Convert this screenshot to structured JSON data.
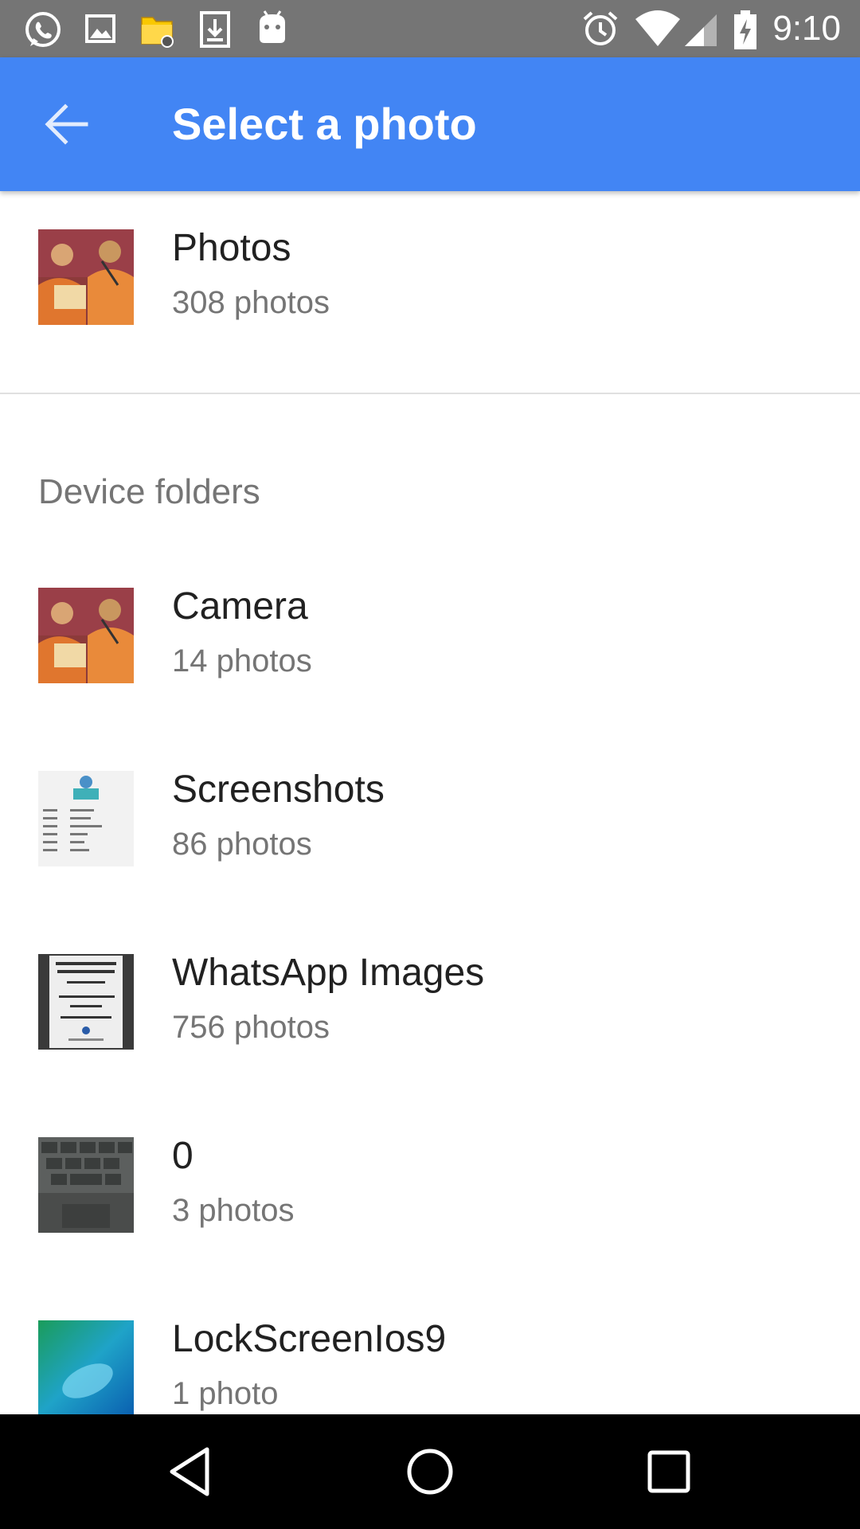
{
  "status_bar": {
    "time": "9:10",
    "left_icons": [
      "whatsapp-icon",
      "gallery-icon",
      "file-manager-icon",
      "download-icon",
      "android-icon"
    ],
    "right_icons": [
      "alarm-icon",
      "wifi-icon",
      "signal-icon",
      "battery-charging-icon"
    ]
  },
  "app_bar": {
    "title": "Select a photo",
    "back_icon": "arrow-back-icon",
    "color": "#4285f4"
  },
  "top_album": {
    "title": "Photos",
    "count": "308 photos"
  },
  "section": {
    "header": "Device folders"
  },
  "folders": [
    {
      "title": "Camera",
      "count": "14 photos"
    },
    {
      "title": "Screenshots",
      "count": "86 photos"
    },
    {
      "title": "WhatsApp Images",
      "count": "756 photos"
    },
    {
      "title": "0",
      "count": "3 photos"
    },
    {
      "title": "LockScreenIos9",
      "count": "1 photo"
    }
  ],
  "nav_bar": {
    "buttons": [
      "back-nav-icon",
      "home-nav-icon",
      "recents-nav-icon"
    ]
  }
}
